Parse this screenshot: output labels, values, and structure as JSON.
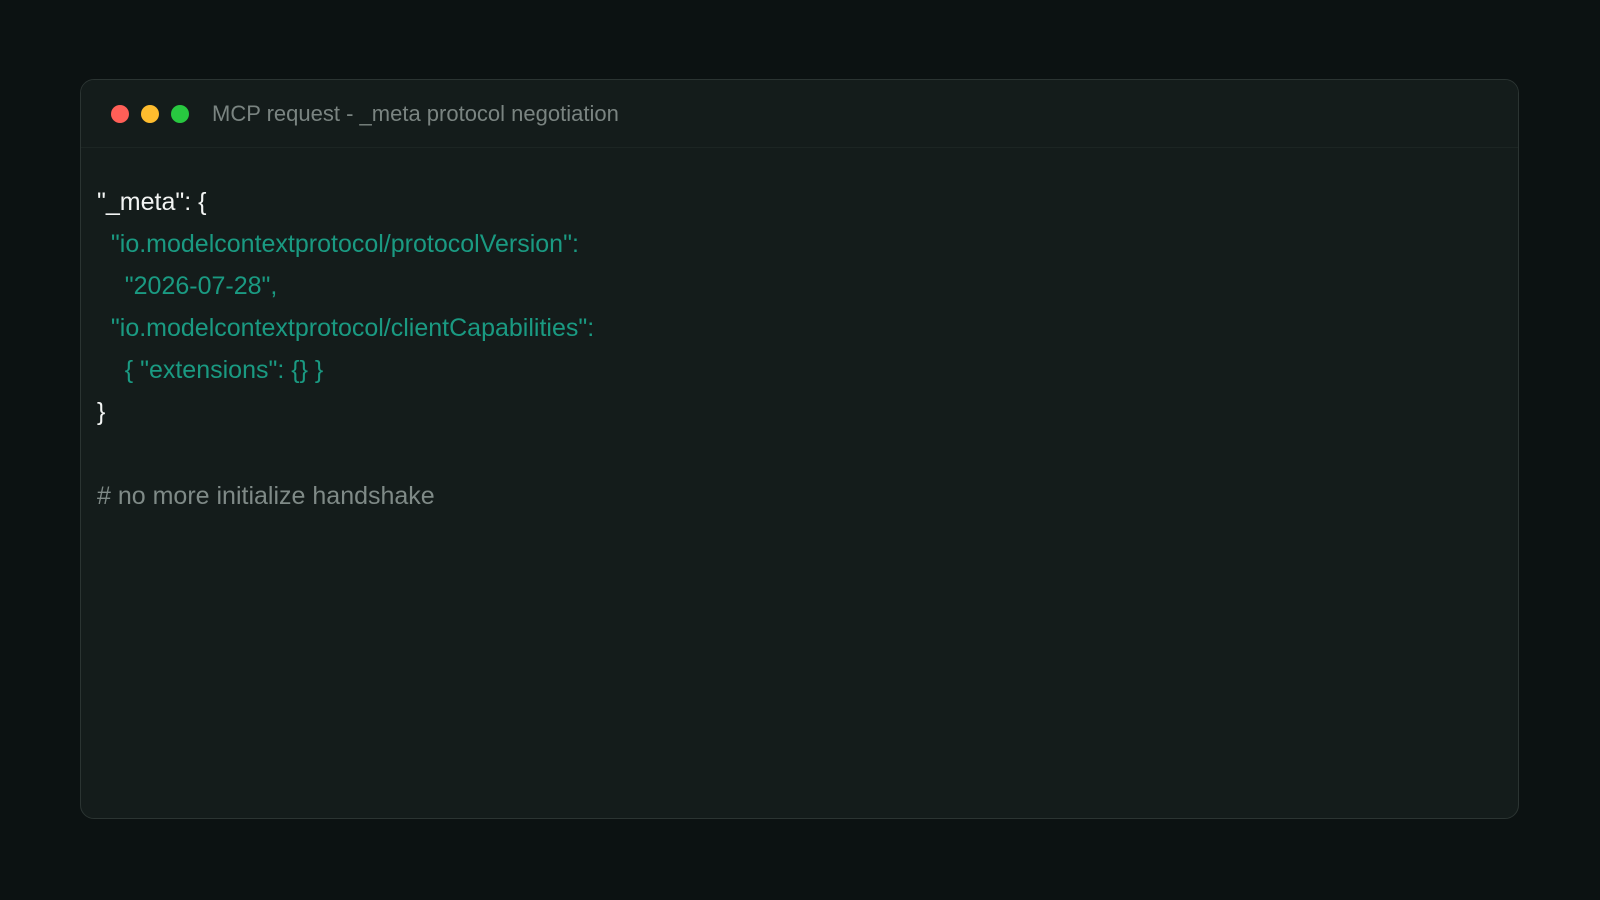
{
  "window": {
    "title": "MCP request - _meta protocol negotiation",
    "controls": {
      "close_color": "#ff5f57",
      "minimize_color": "#febc2e",
      "maximize_color": "#28c840"
    }
  },
  "code": {
    "lines": [
      "\"_meta\": {",
      "  \"io.modelcontextprotocol/protocolVersion\":",
      "    \"2026-07-28\",",
      "  \"io.modelcontextprotocol/clientCapabilities\":",
      "    { \"extensions\": {} }",
      "}",
      "",
      "# no more initialize handshake"
    ]
  },
  "colors": {
    "background": "#0c1212",
    "panel": "#141c1b",
    "key_text": "#f3f5f4",
    "string_text": "#1a9a82",
    "comment_text": "#7f8a87"
  }
}
